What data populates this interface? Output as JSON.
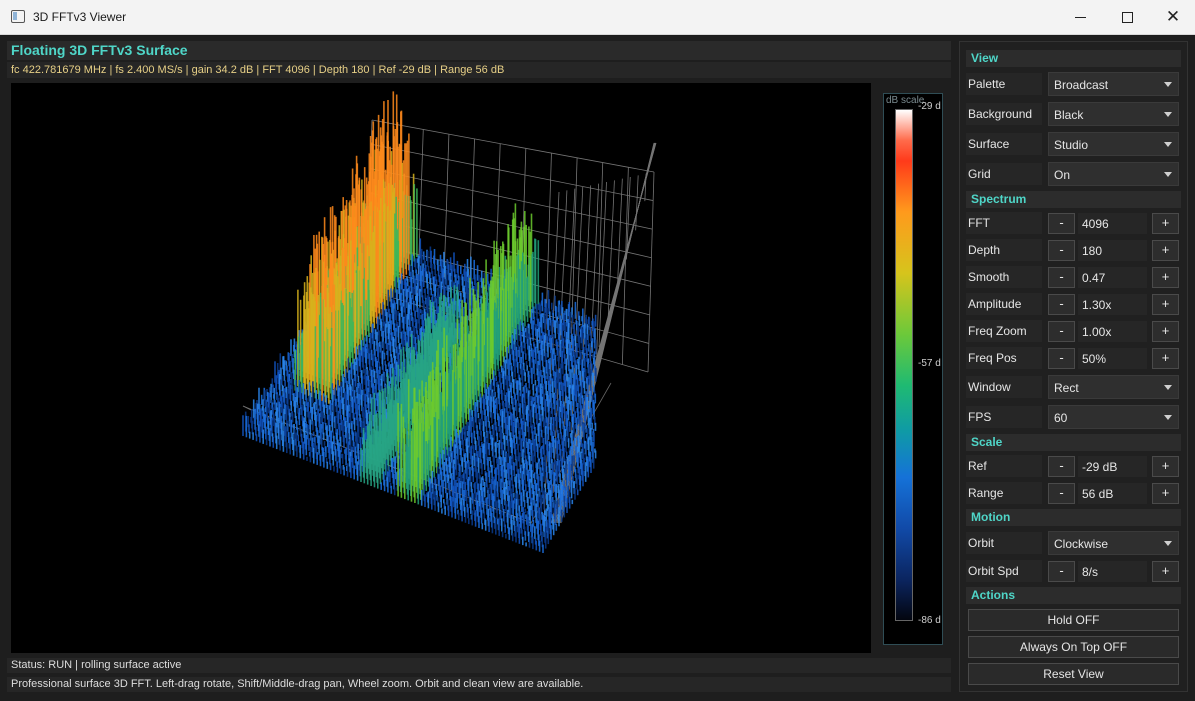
{
  "window": {
    "title": "3D FFTv3 Viewer"
  },
  "header": {
    "title": "Floating 3D FFTv3 Surface",
    "info": "fc 422.781679 MHz | fs 2.400 MS/s | gain 34.2 dB | FFT 4096 | Depth 180 | Ref -29 dB | Range 56 dB"
  },
  "scale": {
    "label": "dB scale",
    "top": "-29 d",
    "mid": "-57 d",
    "bottom": "-86 d"
  },
  "status": {
    "text": "Status: RUN | rolling surface active",
    "hint": "Professional surface 3D FFT. Left-drag rotate, Shift/Middle-drag pan, Wheel zoom. Orbit and clean view are available."
  },
  "panel": {
    "view": {
      "title": "View",
      "palette": {
        "label": "Palette",
        "value": "Broadcast"
      },
      "background": {
        "label": "Background",
        "value": "Black"
      },
      "surface": {
        "label": "Surface",
        "value": "Studio"
      },
      "grid": {
        "label": "Grid",
        "value": "On"
      }
    },
    "spectrum": {
      "title": "Spectrum",
      "fft": {
        "label": "FFT",
        "value": "4096"
      },
      "depth": {
        "label": "Depth",
        "value": "180"
      },
      "smooth": {
        "label": "Smooth",
        "value": "0.47"
      },
      "amplitude": {
        "label": "Amplitude",
        "value": "1.30x"
      },
      "freq_zoom": {
        "label": "Freq Zoom",
        "value": "1.00x"
      },
      "freq_pos": {
        "label": "Freq Pos",
        "value": "50%"
      },
      "window": {
        "label": "Window",
        "value": "Rect"
      },
      "fps": {
        "label": "FPS",
        "value": "60"
      }
    },
    "scale": {
      "title": "Scale",
      "ref": {
        "label": "Ref",
        "value": "-29 dB"
      },
      "range": {
        "label": "Range",
        "value": "56 dB"
      }
    },
    "motion": {
      "title": "Motion",
      "orbit": {
        "label": "Orbit",
        "value": "Clockwise"
      },
      "orbit_spd": {
        "label": "Orbit Spd",
        "value": "8/s"
      }
    },
    "actions": {
      "title": "Actions",
      "hold": "Hold OFF",
      "always_on_top": "Always On Top OFF",
      "reset_view": "Reset View"
    },
    "stepper": {
      "minus": "-",
      "plus": "+"
    }
  }
}
